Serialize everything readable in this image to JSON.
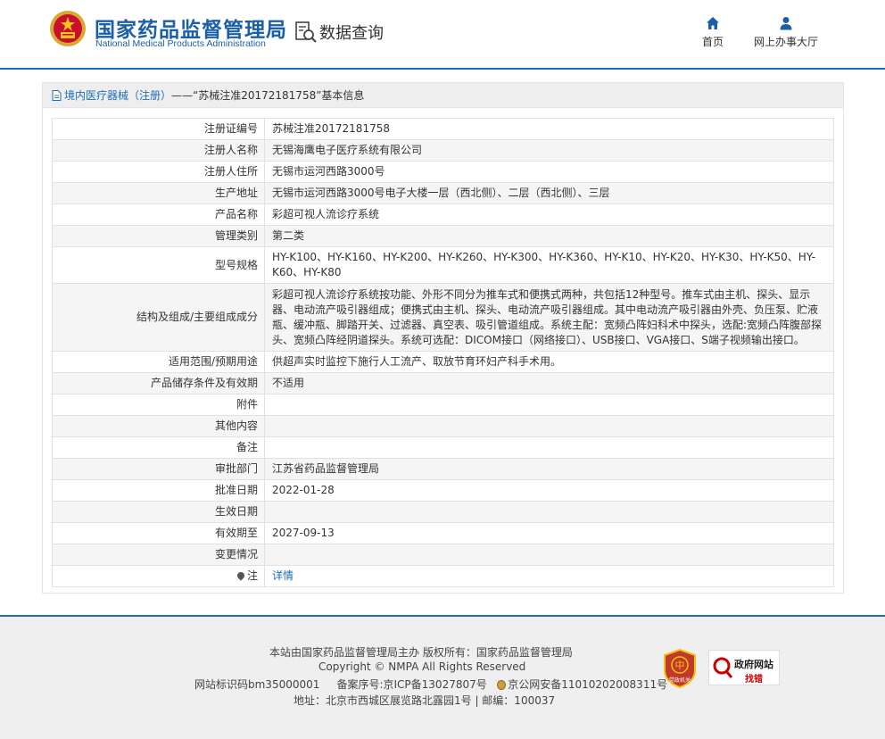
{
  "header": {
    "brand_cn": "国家药品监督管理局",
    "brand_en": "National Medical Products Administration",
    "query_label": "数据查询",
    "nav": [
      {
        "label": "首页",
        "icon": "home-icon"
      },
      {
        "label": "网上办事大厅",
        "icon": "user-icon"
      }
    ]
  },
  "panel": {
    "breadcrumb_prefix": "境内医疗器械（注册）",
    "breadcrumb_sep": " —— ",
    "breadcrumb_title": "“苏械注准20172181758”基本信息"
  },
  "record": {
    "rows": [
      {
        "label": "注册证编号",
        "value": "苏械注准20172181758"
      },
      {
        "label": "注册人名称",
        "value": "无锡海鹰电子医疗系统有限公司"
      },
      {
        "label": "注册人住所",
        "value": "无锡市运河西路3000号"
      },
      {
        "label": "生产地址",
        "value": "无锡市运河西路3000号电子大楼一层（西北侧）、二层（西北侧）、三层"
      },
      {
        "label": "产品名称",
        "value": "彩超可视人流诊疗系统"
      },
      {
        "label": "管理类别",
        "value": "第二类"
      },
      {
        "label": "型号规格",
        "value": "HY-K100、HY-K160、HY-K200、HY-K260、HY-K300、HY-K360、HY-K10、HY-K20、HY-K30、HY-K50、HY-K60、HY-K80"
      },
      {
        "label": "结构及组成/主要组成成分",
        "value": "彩超可视人流诊疗系统按功能、外形不同分为推车式和便携式两种，共包括12种型号。推车式由主机、探头、显示器、电动流产吸引器组成；便携式由主机、探头、电动流产吸引器组成。其中电动流产吸引器由外壳、负压泵、贮液瓶、缓冲瓶、脚踏开关、过滤器、真空表、吸引管道组成。系统主配：宽频凸阵妇科术中探头，选配:宽频凸阵腹部探头、宽频凸阵经阴道探头。系统可选配：DICOM接口（网络接口）、USB接口、VGA接口、S端子视频输出接口。"
      },
      {
        "label": "适用范围/预期用途",
        "value": "供超声实时监控下施行人工流产、取放节育环妇产科手术用。"
      },
      {
        "label": "产品储存条件及有效期",
        "value": "不适用"
      },
      {
        "label": "附件",
        "value": ""
      },
      {
        "label": "其他内容",
        "value": ""
      },
      {
        "label": "备注",
        "value": ""
      },
      {
        "label": "审批部门",
        "value": "江苏省药品监督管理局"
      },
      {
        "label": "批准日期",
        "value": "2022-01-28"
      },
      {
        "label": "生效日期",
        "value": ""
      },
      {
        "label": "有效期至",
        "value": "2027-09-13"
      },
      {
        "label": "变更情况",
        "value": ""
      }
    ],
    "note_label": "注",
    "note_link": "详情"
  },
  "footer": {
    "line1": "本站由国家药品监督管理局主办 版权所有：国家药品监督管理局",
    "line2": "Copyright © NMPA All Rights Reserved",
    "site_id": "网站标识码bm35000001",
    "icp": "备案序号:京ICP备13027807号",
    "police": "京公网安备11010202008311号",
    "address": "地址：北京市西城区展览路北露园1号 | 邮编：100037",
    "badge_red_text": "党政机关",
    "badge_gov_line1": "政府网站",
    "badge_gov_line2": "找错"
  },
  "colors": {
    "brand_blue": "#1a5fa8",
    "link_blue": "#1c6eb8",
    "badge_red": "#c0392b"
  }
}
